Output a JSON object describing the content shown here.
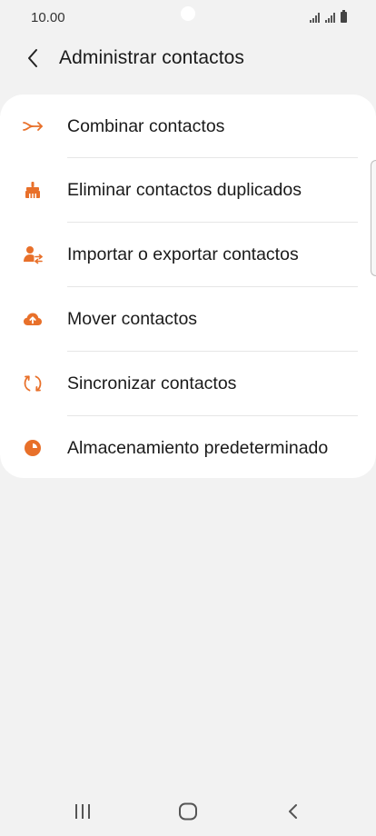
{
  "status_bar": {
    "time": "10.00"
  },
  "header": {
    "title": "Administrar contactos",
    "back_icon": "chevron-left-icon"
  },
  "menu": {
    "items": [
      {
        "label": "Combinar contactos",
        "icon": "merge-arrow-icon"
      },
      {
        "label": "Eliminar contactos duplicados",
        "icon": "broom-icon"
      },
      {
        "label": "Importar o exportar contactos",
        "icon": "person-transfer-icon"
      },
      {
        "label": "Mover contactos",
        "icon": "cloud-upload-icon"
      },
      {
        "label": "Sincronizar contactos",
        "icon": "sync-icon"
      },
      {
        "label": "Almacenamiento predeterminado",
        "icon": "pie-storage-icon"
      }
    ]
  },
  "nav_bar": {
    "recent_icon": "recent-apps-icon",
    "home_icon": "home-icon",
    "back_icon": "back-icon"
  },
  "colors": {
    "accent": "#e8702a",
    "background": "#f2f2f2",
    "card": "#ffffff"
  }
}
